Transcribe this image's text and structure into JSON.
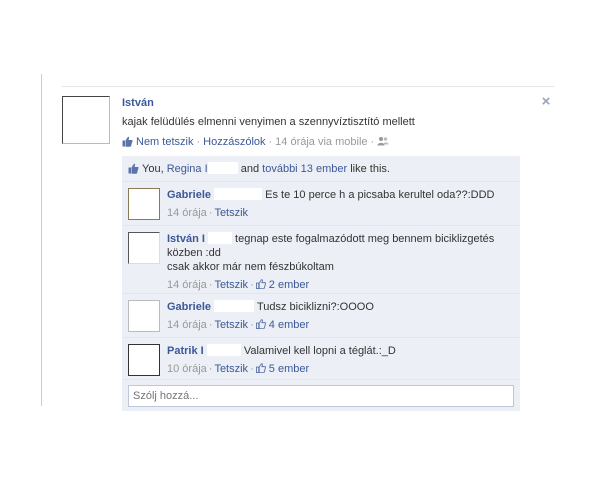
{
  "post": {
    "author": "István",
    "text": "kajak felüdülés elmenni venyimen a szennyvíztisztító mellett",
    "actions": {
      "unlike": "Nem tetszik",
      "comment": "Hozzászólok",
      "timestamp": "14 órája via mobile"
    },
    "close_icon": "×"
  },
  "likes": {
    "prefix": "You,",
    "person": "Regina I",
    "and": "and",
    "others_link": "további 13 ember",
    "suffix": "like this."
  },
  "comments": [
    {
      "name": "Gabriele",
      "text": "Es te 10 perce h a picsaba kerultel oda??:DDD",
      "time": "14 órája",
      "action": "Tetszik",
      "likes": ""
    },
    {
      "name": "István I",
      "text_line1": "tegnap este fogalmazódott meg bennem biciklizgetés",
      "text_line2": "közben :dd",
      "text_line3": "csak akkor már nem fészbúkoltam",
      "time": "14 órája",
      "action": "Tetszik",
      "likes": "2 ember"
    },
    {
      "name": "Gabriele",
      "text": "Tudsz biciklizni?:OOOO",
      "time": "14 órája",
      "action": "Tetszik",
      "likes": "4 ember"
    },
    {
      "name": "Patrik I",
      "text": "Valamivel kell lopni a téglát.:_D",
      "time": "10 órája",
      "action": "Tetszik",
      "likes": "5 ember"
    }
  ],
  "reply": {
    "placeholder": "Szólj hozzá..."
  },
  "separators": {
    "dot": "·"
  }
}
